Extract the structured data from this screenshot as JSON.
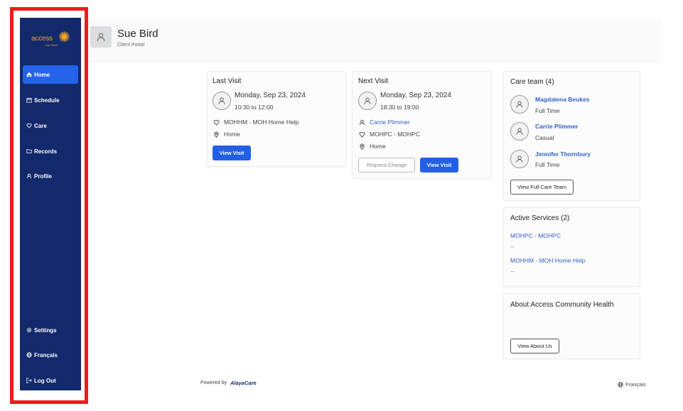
{
  "brand": {
    "logo_text": "access",
    "logo_sub": "Ute Rsine"
  },
  "sidebar": {
    "items": [
      {
        "label": "Home",
        "icon": "home-icon"
      },
      {
        "label": "Schedule",
        "icon": "calendar-icon"
      },
      {
        "label": "Care",
        "icon": "heart-icon"
      },
      {
        "label": "Records",
        "icon": "folder-icon"
      },
      {
        "label": "Profile",
        "icon": "user-icon"
      },
      {
        "label": "Settings",
        "icon": "gear-icon"
      },
      {
        "label": "Français",
        "icon": "globe-icon"
      },
      {
        "label": "Log Out",
        "icon": "logout-icon"
      }
    ]
  },
  "header": {
    "name": "Sue Bird",
    "subtitle": "Client Portal"
  },
  "last_visit": {
    "title": "Last Visit",
    "date": "Monday, Sep 23, 2024",
    "time": "10:30 to 12:00",
    "service": "MOHHM - MOH Home Help",
    "location": "Home",
    "button": "View Visit"
  },
  "next_visit": {
    "title": "Next Visit",
    "date": "Monday, Sep 23, 2024",
    "time": "18:30 to 19:00",
    "caregiver": "Carrie Plimmer",
    "service": "MOHPC - MOHPC",
    "location": "Home",
    "request_button": "Request Change",
    "view_button": "View Visit"
  },
  "care_team": {
    "title": "Care team (4)",
    "members": [
      {
        "name": "Magdalena Beukes",
        "role": "Full Time"
      },
      {
        "name": "Carrie Plimmer",
        "role": "Casual"
      },
      {
        "name": "Jennifer Thornbury",
        "role": "Full Time"
      }
    ],
    "button": "View Full Care Team"
  },
  "active_services": {
    "title": "Active Services (2)",
    "services": [
      {
        "name": "MOHPC - MOHPC",
        "detail": "--"
      },
      {
        "name": "MOHHM - MOH Home Help",
        "detail": "--"
      }
    ]
  },
  "about": {
    "title": "About Access Community Health",
    "button": "View About Us"
  },
  "footer": {
    "powered_by": "Powered by",
    "brand": "AlayaCare",
    "language": "Français"
  },
  "colors": {
    "sidebar": "#12296b",
    "active": "#2563eb",
    "primary_button": "#2160e3",
    "link": "#2f62c9",
    "highlight_frame": "#ee1c1c"
  }
}
